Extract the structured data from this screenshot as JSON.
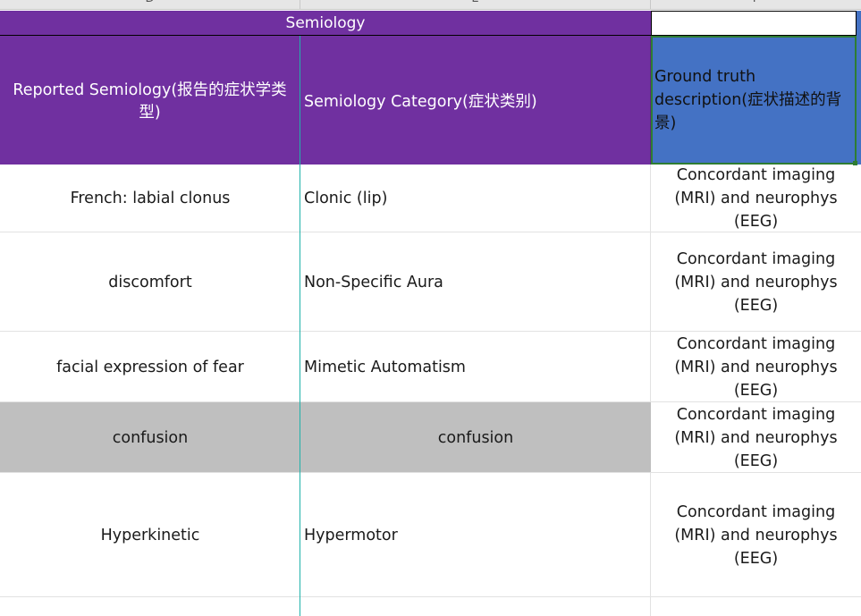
{
  "column_headers": {
    "d": "D",
    "e": "E",
    "f": "F"
  },
  "group_header": {
    "label": "Semiology"
  },
  "headers": {
    "reported": "Reported Semiology(报告的症状学类型)",
    "category": "Semiology Category(症状类别)",
    "ground_truth": "Ground truth description(症状描述的背景)"
  },
  "rows": [
    {
      "reported": "French: labial clonus",
      "category": "Clonic (lip)",
      "ground_truth": "Concordant imaging (MRI) and neurophys (EEG)"
    },
    {
      "reported": "discomfort",
      "category": "Non-Specific Aura",
      "ground_truth": "Concordant imaging (MRI) and neurophys (EEG)"
    },
    {
      "reported": "facial expression of fear",
      "category": "Mimetic Automatism",
      "ground_truth": "Concordant imaging (MRI) and neurophys (EEG)"
    },
    {
      "reported": "confusion",
      "category": "confusion",
      "ground_truth": "Concordant imaging (MRI) and neurophys (EEG)"
    },
    {
      "reported": "Hyperkinetic",
      "category": "Hypermotor",
      "ground_truth": "Concordant imaging (MRI) and neurophys (EEG)"
    }
  ],
  "colors": {
    "header_purple": "#7030a0",
    "selected_blue": "#4472c4",
    "selection_green": "#2e7d32",
    "highlight_gray": "#bfbfbf"
  }
}
